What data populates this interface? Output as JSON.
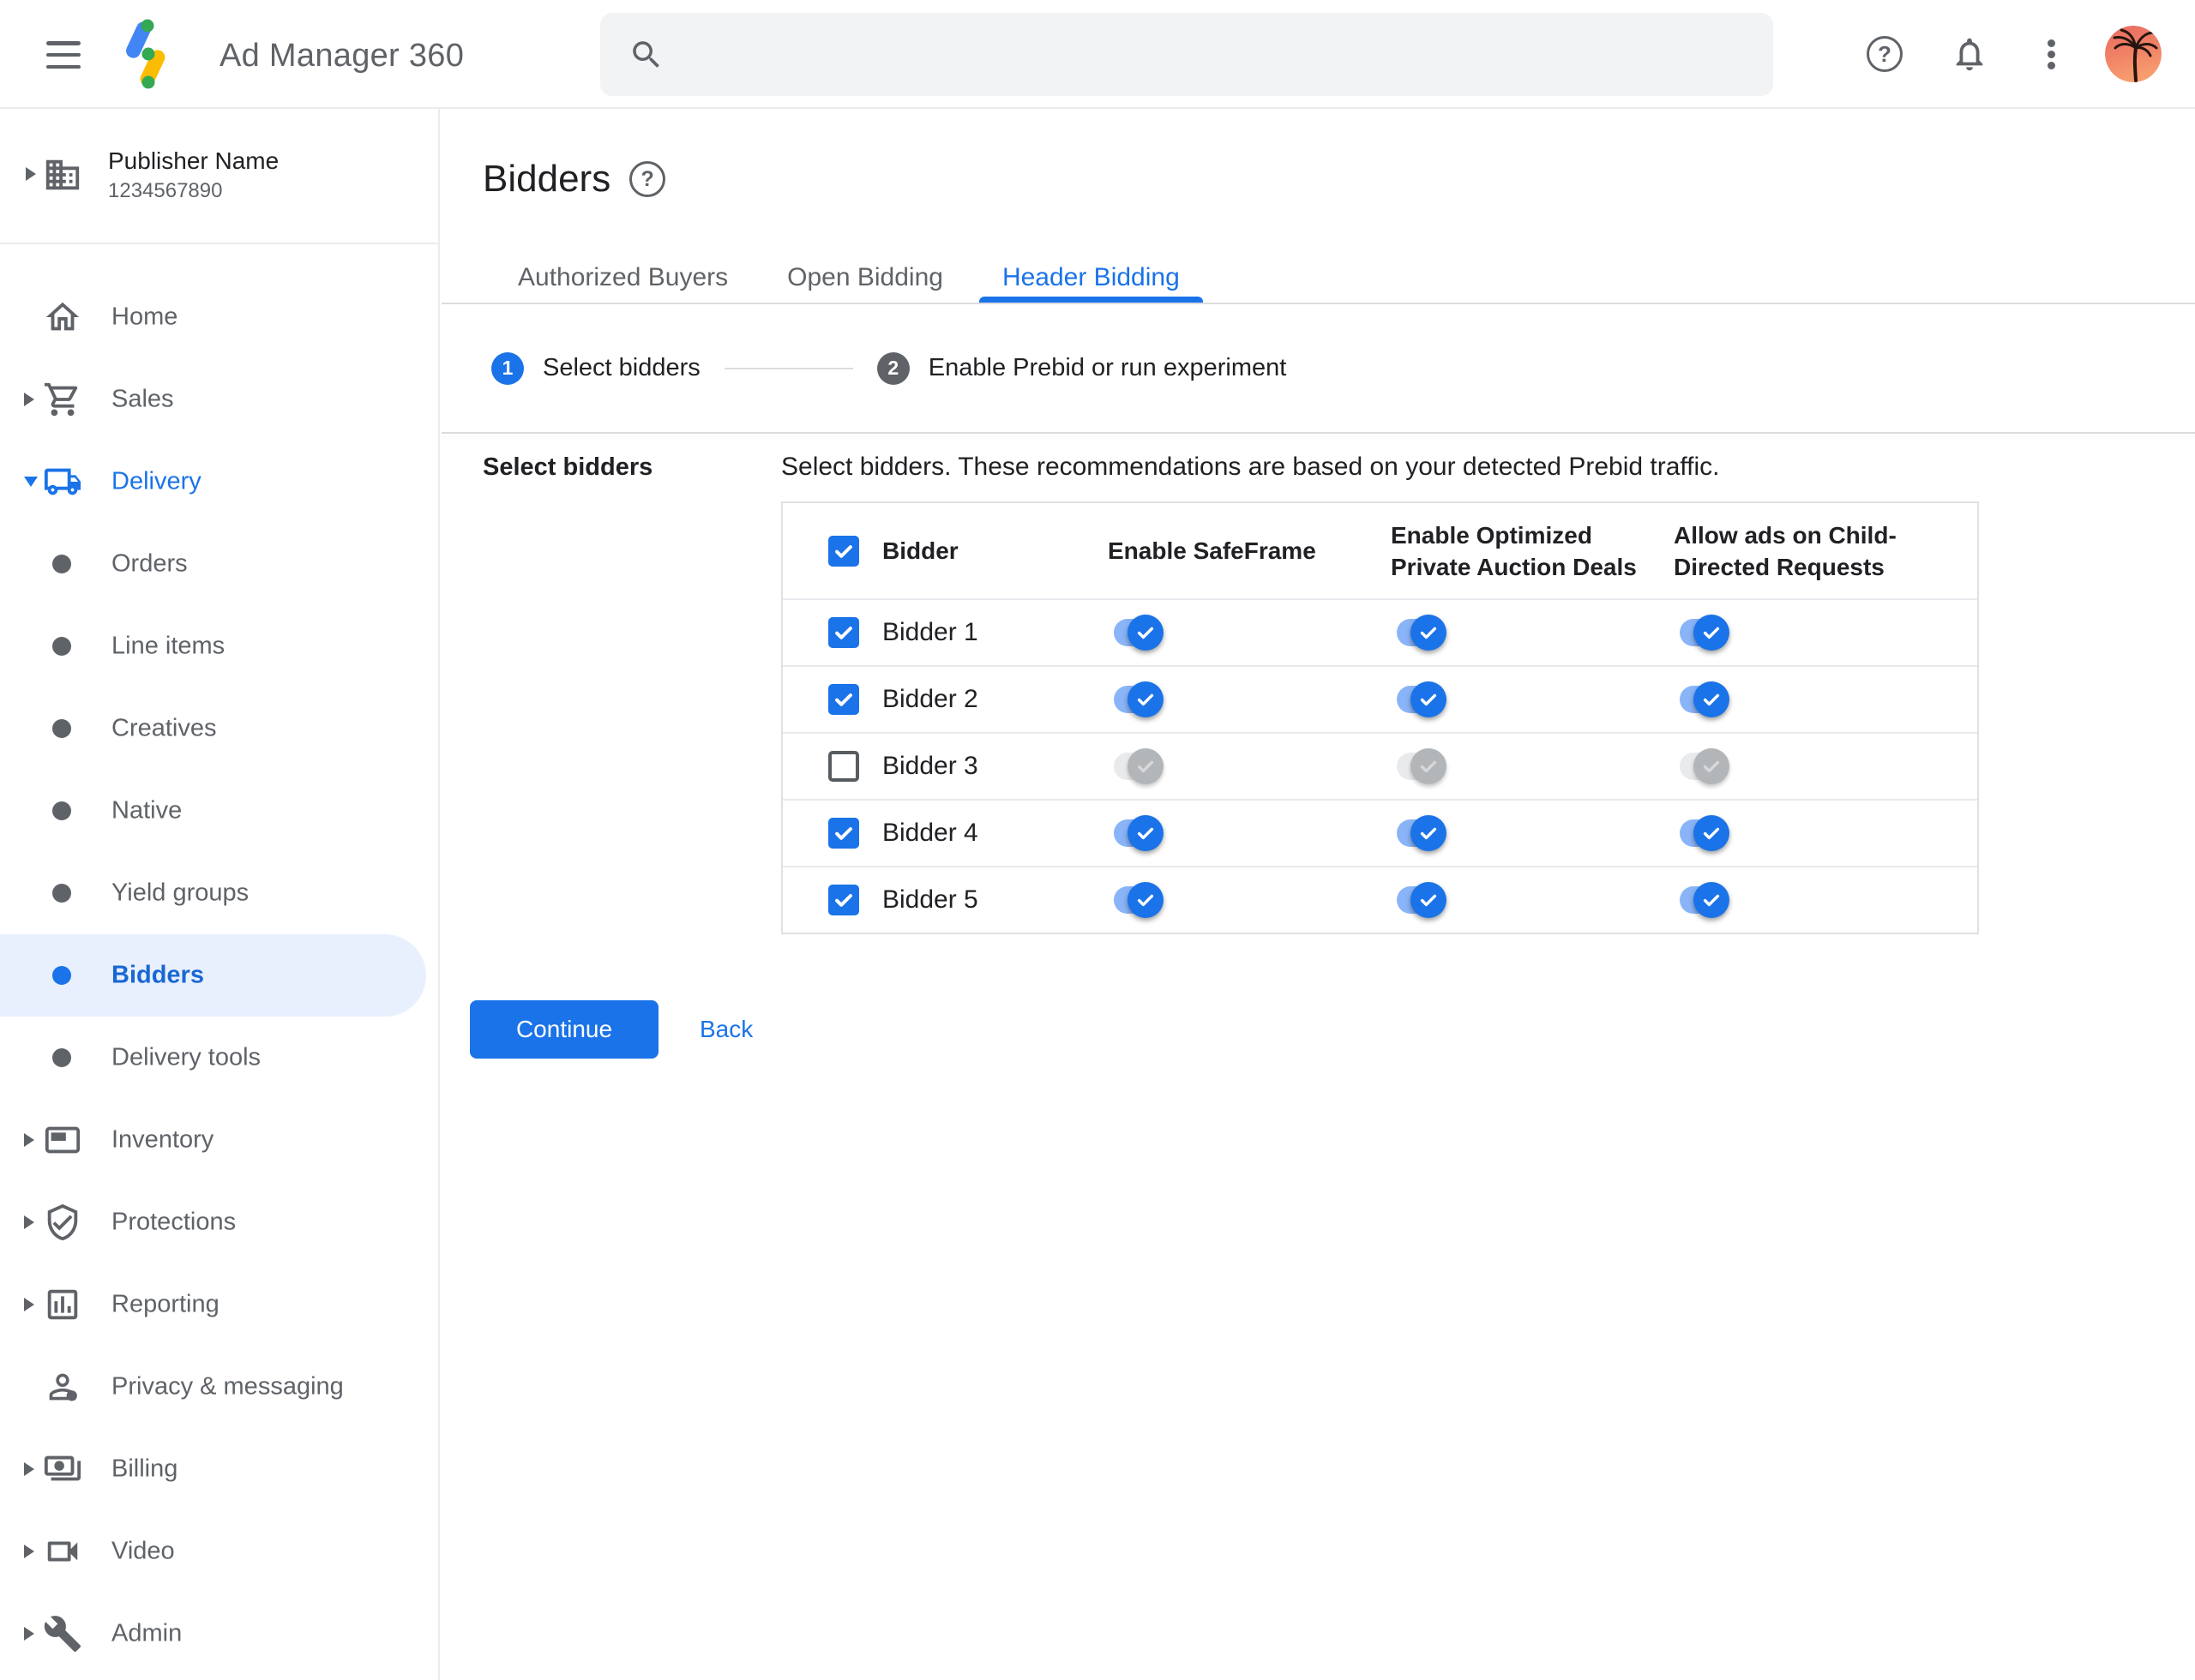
{
  "colors": {
    "accent": "#1a73e8",
    "accent_light_track": "#8ab4f8",
    "selected_item_bg": "#e8f0fe",
    "selected_item_text": "#1967d2",
    "text_primary": "#202124",
    "text_secondary": "#5f6368",
    "border": "#dadce0",
    "logo_blue": "#4285f4",
    "logo_yellow": "#fbbc04",
    "logo_green": "#34a853",
    "disabled_toggle": "#b3b6b9"
  },
  "appbar": {
    "title": "Ad Manager 360",
    "search": {
      "placeholder": "",
      "value": ""
    }
  },
  "sidebar": {
    "publisher": {
      "name": "Publisher Name",
      "id": "1234567890"
    },
    "items": [
      {
        "id": "home",
        "label": "Home",
        "icon": "home"
      },
      {
        "id": "sales",
        "label": "Sales",
        "icon": "cart",
        "arrow": "right"
      },
      {
        "id": "delivery",
        "label": "Delivery",
        "icon": "truck",
        "arrow": "down",
        "active": true,
        "expanded": true
      },
      {
        "id": "orders",
        "label": "Orders",
        "icon": "bullet",
        "sub": true
      },
      {
        "id": "line-items",
        "label": "Line items",
        "icon": "bullet",
        "sub": true
      },
      {
        "id": "creatives",
        "label": "Creatives",
        "icon": "bullet",
        "sub": true
      },
      {
        "id": "native",
        "label": "Native",
        "icon": "bullet",
        "sub": true
      },
      {
        "id": "yield-groups",
        "label": "Yield groups",
        "icon": "bullet",
        "sub": true
      },
      {
        "id": "bidders",
        "label": "Bidders",
        "icon": "bullet",
        "sub": true,
        "selected": true
      },
      {
        "id": "delivery-tools",
        "label": "Delivery tools",
        "icon": "bullet",
        "sub": true
      },
      {
        "id": "inventory",
        "label": "Inventory",
        "icon": "inventory",
        "arrow": "right"
      },
      {
        "id": "protections",
        "label": "Protections",
        "icon": "shield",
        "arrow": "right"
      },
      {
        "id": "reporting",
        "label": "Reporting",
        "icon": "report",
        "arrow": "right"
      },
      {
        "id": "privacy-messaging",
        "label": "Privacy & messaging",
        "icon": "privacy"
      },
      {
        "id": "billing",
        "label": "Billing",
        "icon": "billing",
        "arrow": "right"
      },
      {
        "id": "video",
        "label": "Video",
        "icon": "video",
        "arrow": "right"
      },
      {
        "id": "admin",
        "label": "Admin",
        "icon": "admin",
        "arrow": "right"
      }
    ]
  },
  "main": {
    "title": "Bidders",
    "tabs": [
      {
        "id": "authorized-buyers",
        "label": "Authorized Buyers",
        "active": false
      },
      {
        "id": "open-bidding",
        "label": "Open Bidding",
        "active": false
      },
      {
        "id": "header-bidding",
        "label": "Header Bidding",
        "active": true
      }
    ],
    "stepper": [
      {
        "number": "1",
        "label": "Select bidders",
        "state": "active"
      },
      {
        "number": "2",
        "label": "Enable Prebid or run experiment",
        "state": "upcoming"
      }
    ],
    "section_label": "Select bidders",
    "description": "Select bidders. These recommendations are based on your detected Prebid traffic.",
    "table": {
      "select_all_checked": true,
      "columns": [
        "Bidder",
        "Enable SafeFrame",
        "Enable Optimized\nPrivate Auction Deals",
        "Allow ads on Child-\nDirected Requests"
      ],
      "toggle_keys": [
        "enable-safeframe",
        "optimized-private-auction-deals",
        "child-directed-requests"
      ],
      "rows": [
        {
          "name": "Bidder 1",
          "checked": true,
          "toggles": [
            {
              "on": true,
              "disabled": false
            },
            {
              "on": true,
              "disabled": false
            },
            {
              "on": true,
              "disabled": false
            }
          ]
        },
        {
          "name": "Bidder 2",
          "checked": true,
          "toggles": [
            {
              "on": true,
              "disabled": false
            },
            {
              "on": true,
              "disabled": false
            },
            {
              "on": true,
              "disabled": false
            }
          ]
        },
        {
          "name": "Bidder 3",
          "checked": false,
          "toggles": [
            {
              "on": true,
              "disabled": true
            },
            {
              "on": true,
              "disabled": true
            },
            {
              "on": true,
              "disabled": true
            }
          ]
        },
        {
          "name": "Bidder 4",
          "checked": true,
          "toggles": [
            {
              "on": true,
              "disabled": false
            },
            {
              "on": true,
              "disabled": false
            },
            {
              "on": true,
              "disabled": false
            }
          ]
        },
        {
          "name": "Bidder 5",
          "checked": true,
          "toggles": [
            {
              "on": true,
              "disabled": false
            },
            {
              "on": true,
              "disabled": false
            },
            {
              "on": true,
              "disabled": false
            }
          ]
        }
      ]
    },
    "actions": {
      "continue": "Continue",
      "back": "Back"
    }
  }
}
